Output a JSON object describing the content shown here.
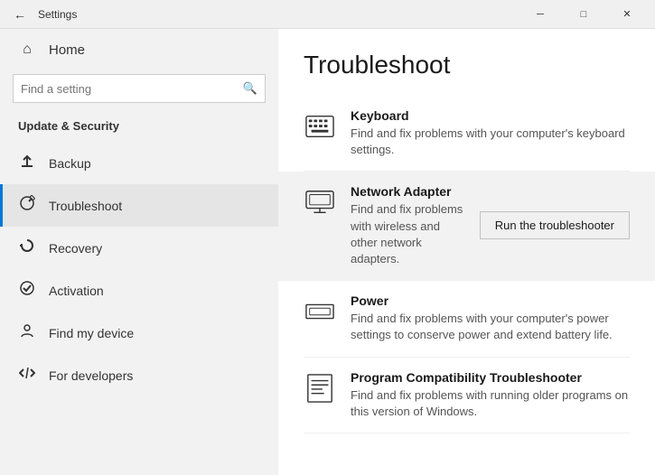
{
  "titlebar": {
    "back_label": "←",
    "title": "Settings",
    "minimize_label": "─",
    "maximize_label": "□",
    "close_label": "✕"
  },
  "sidebar": {
    "home_label": "Home",
    "search_placeholder": "Find a setting",
    "search_icon": "🔍",
    "section_title": "Update & Security",
    "items": [
      {
        "id": "backup",
        "label": "Backup",
        "icon": "↑"
      },
      {
        "id": "troubleshoot",
        "label": "Troubleshoot",
        "icon": "🔧",
        "active": true
      },
      {
        "id": "recovery",
        "label": "Recovery",
        "icon": "↺"
      },
      {
        "id": "activation",
        "label": "Activation",
        "icon": "✓"
      },
      {
        "id": "find-my-device",
        "label": "Find my device",
        "icon": "👤"
      },
      {
        "id": "for-developers",
        "label": "For developers",
        "icon": "⌘"
      }
    ]
  },
  "content": {
    "title": "Troubleshoot",
    "items": [
      {
        "id": "keyboard",
        "title": "Keyboard",
        "description": "Find and fix problems with your computer's keyboard settings.",
        "highlighted": false
      },
      {
        "id": "network-adapter",
        "title": "Network Adapter",
        "description": "Find and fix problems with wireless and other network adapters.",
        "highlighted": true,
        "run_button_label": "Run the troubleshooter"
      },
      {
        "id": "power",
        "title": "Power",
        "description": "Find and fix problems with your computer's power settings to conserve power and extend battery life.",
        "highlighted": false
      },
      {
        "id": "program-compat",
        "title": "Program Compatibility Troubleshooter",
        "description": "Find and fix problems with running older programs on this version of Windows.",
        "highlighted": false
      }
    ]
  }
}
